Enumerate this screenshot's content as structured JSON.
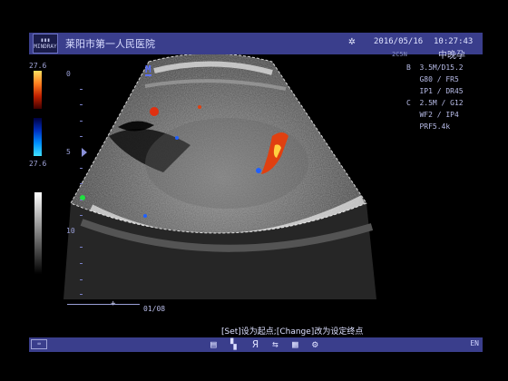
{
  "header": {
    "logo_text": "MINDRAY",
    "hospital_name": "莱阳市第一人民医院",
    "freeze_icon": "snowflake-icon",
    "date": "2016/05/16",
    "time": "10:27:43",
    "probe": "2C5N",
    "preset": "中晚孕"
  },
  "params": {
    "lines": [
      "B  3.5M/D15.2",
      "   G80 / FR5",
      "   IP1 / DR45",
      "C  2.5M / G12",
      "   WF2 / IP4",
      "   PRF5.4k"
    ]
  },
  "color_scale": {
    "top": "27.6",
    "bottom": "27.6"
  },
  "depth_labels": [
    "0",
    "5",
    "10"
  ],
  "image_marker": "M",
  "cine": {
    "marker": "+",
    "frame": "01/08"
  },
  "hint": "[Set]设为起点;[Change]改为设定终点",
  "bottom_bar": {
    "keyboard_icon": "keyboard-icon",
    "tools": [
      "image-icon",
      "measure-icon",
      "annotate-icon",
      "transfer-icon",
      "grid-icon"
    ],
    "language": "EN"
  },
  "colors": {
    "bar": "#3a3e8c",
    "text": "#b8bce8",
    "accent": "#5a70ff"
  }
}
